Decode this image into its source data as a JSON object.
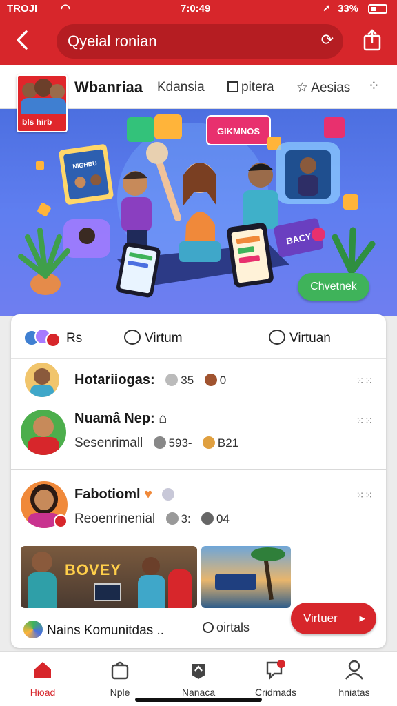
{
  "status": {
    "carrier": "TROJI",
    "time": "7:0:49",
    "battery": "33%"
  },
  "search": {
    "query": "Qyeial ronian"
  },
  "channel": {
    "logo_text": "bls hirb",
    "name": "Wbanriaa",
    "tabs": [
      "Kdansia",
      "pitera",
      "Aesias"
    ]
  },
  "hero": {
    "sign_top": "GIKMNOS",
    "card_left": "NIGHBU",
    "card_right": "BACY",
    "button": "Chvetnek"
  },
  "filters": {
    "f1": "Rs",
    "f2": "Virtum",
    "f3": "Virtuan"
  },
  "feed": [
    {
      "name": "Hotariiogas:",
      "stat1": "35",
      "stat2": "0"
    },
    {
      "name": "Nuamâ Nep:",
      "sub": "Sesenrimall",
      "stat1": "593-",
      "stat2": "B21"
    },
    {
      "name": "Fabotioml",
      "sub": "Reoenrinenial",
      "stat1": "3:",
      "stat2": "04"
    }
  ],
  "thumb_sign": "BOVEY",
  "community": {
    "label": "Nains Komunitdas ..",
    "virtual": "oirtals",
    "button": "Virtuer"
  },
  "tabbar": [
    "Hioad",
    "Nple",
    "Nanaca",
    "Cridmads",
    "hniatas"
  ],
  "colors": {
    "brand_red": "#d7262b",
    "hero_blue": "#5f7ef0",
    "cta_green": "#3fb35a"
  }
}
